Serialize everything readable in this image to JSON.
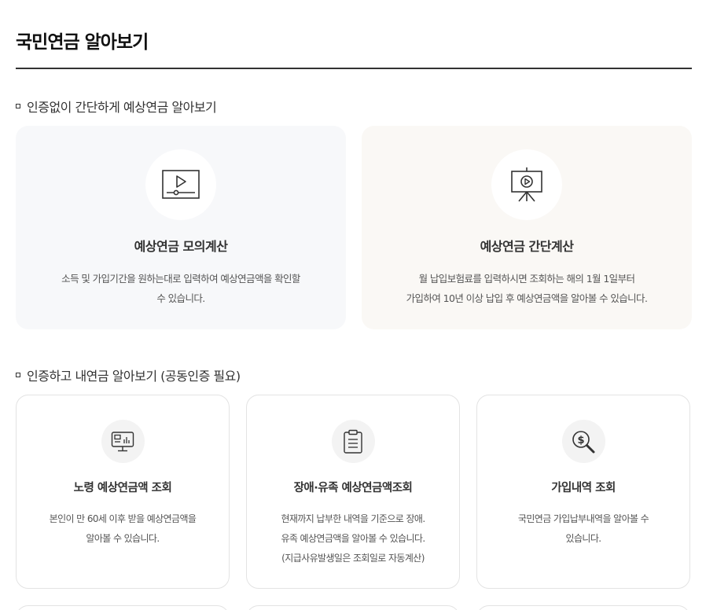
{
  "page": {
    "title": "국민연금 알아보기"
  },
  "sections": [
    {
      "heading": "인증없이 간단하게 예상연금 알아보기",
      "cards": [
        {
          "icon": "video-player-icon",
          "title": "예상연금 모의계산",
          "desc_line1": "소득 및 가입기간을 원하는대로 입력하여 예상연금액을 확인할",
          "desc_line2": "수 있습니다."
        },
        {
          "icon": "presentation-board-icon",
          "title": "예상연금 간단계산",
          "desc_line1": "월 납입보험료를 입력하시면 조회하는 해의 1월 1일부터",
          "desc_line2": "가입하여 10년 이상 납입 후 예상연금액을 알아볼 수 있습니다."
        }
      ]
    },
    {
      "heading": "인증하고 내연금 알아보기 (공동인증 필요)",
      "cards": [
        {
          "icon": "monitor-chart-icon",
          "title": "노령 예상연금액 조회",
          "desc_line1": "본인이 만 60세 이후 받을 예상연금액을",
          "desc_line2": "알아볼 수 있습니다.",
          "desc_line3": ""
        },
        {
          "icon": "clipboard-icon",
          "title": "장애·유족 예상연금액조회",
          "desc_line1": "현재까지 납부한 내역을 기준으로 장애.",
          "desc_line2": "유족 예상연금액을 알아볼 수 있습니다.",
          "desc_line3": "(지급사유발생일은 조회일로 자동계산)"
        },
        {
          "icon": "dollar-search-icon",
          "title": "가입내역 조회",
          "desc_line1": "국민연금 가입납부내역을 알아볼 수",
          "desc_line2": "있습니다.",
          "desc_line3": ""
        }
      ]
    }
  ]
}
